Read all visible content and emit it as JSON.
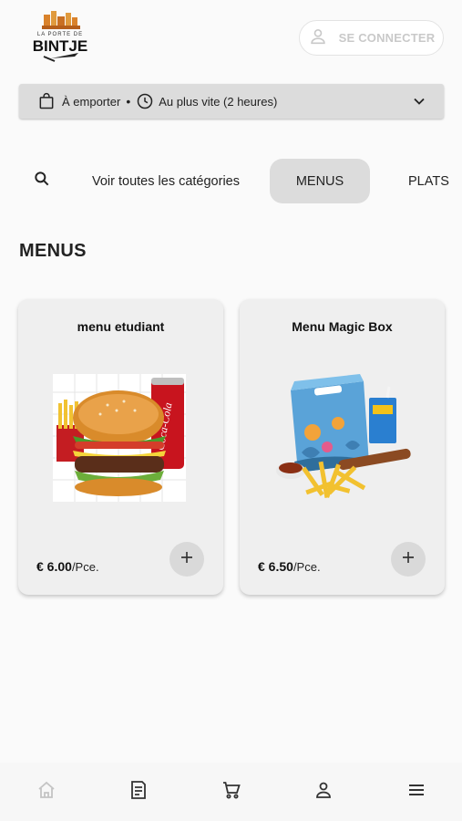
{
  "header": {
    "logo_text": "LA PORTE DE BINTJE",
    "login_label": "SE CONNECTER"
  },
  "order_bar": {
    "mode": "À emporter",
    "separator": "•",
    "time": "Au plus vite (2 heures)"
  },
  "categories": {
    "all_label": "Voir toutes les catégories",
    "items": [
      "MENUS",
      "PLATS"
    ],
    "active": "MENUS"
  },
  "section": {
    "title": "MENUS"
  },
  "products": [
    {
      "name": "menu etudiant",
      "price": "€ 6.00",
      "unit": "/Pce."
    },
    {
      "name": "Menu Magic Box",
      "price": "€ 6.50",
      "unit": "/Pce."
    }
  ],
  "bottom_nav": [
    "home-icon",
    "receipt-icon",
    "cart-icon",
    "user-icon",
    "menu-icon"
  ],
  "colors": {
    "background": "#fafafa",
    "card": "#efefef",
    "active_tab": "#dcdcdc",
    "muted": "#c9c9c9"
  }
}
